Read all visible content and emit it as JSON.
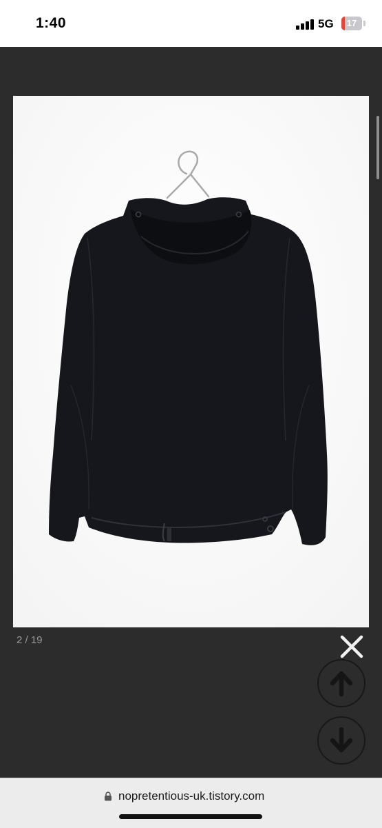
{
  "status_bar": {
    "time": "1:40",
    "network": "5G",
    "battery": "17"
  },
  "viewer": {
    "image_counter": "2 / 19",
    "image_alt": "Black hooded jacket on hanger, back view",
    "icons": {
      "close": "close-icon",
      "previous": "arrow-up-icon",
      "next": "arrow-down-icon"
    }
  },
  "browser": {
    "url": "nopretentious-uk.tistory.com",
    "lock": "lock-icon"
  },
  "colors": {
    "viewer_bg": "#2c2c2c",
    "photo_bg": "#fdfdfd",
    "jacket": "#15171c",
    "battery_fill": "#e0483c"
  }
}
